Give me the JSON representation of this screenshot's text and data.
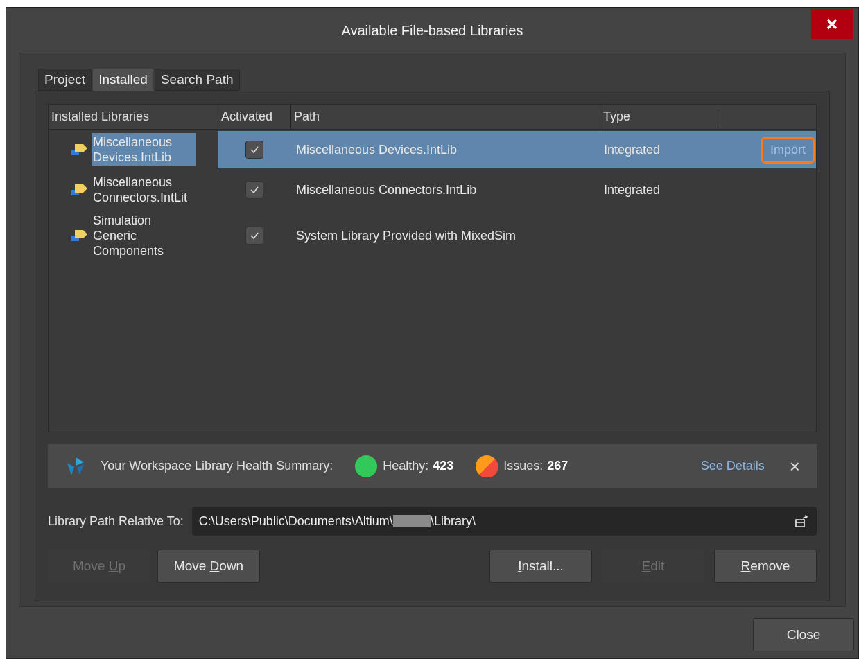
{
  "window": {
    "title": "Available File-based Libraries"
  },
  "tabs": [
    {
      "label": "Project",
      "selected": false
    },
    {
      "label": "Installed",
      "selected": true
    },
    {
      "label": "Search Path",
      "selected": false
    }
  ],
  "table": {
    "columns": [
      "Installed Libraries",
      "Activated",
      "Path",
      "Type"
    ],
    "rows": [
      {
        "name": "Miscellaneous Devices.IntLib",
        "activated": true,
        "path": "Miscellaneous Devices.IntLib",
        "type": "Integrated",
        "selected": true,
        "action": {
          "label": "Import",
          "highlighted": true
        }
      },
      {
        "name": "Miscellaneous Connectors.IntLit",
        "activated": true,
        "path": "Miscellaneous Connectors.IntLib",
        "type": "Integrated",
        "selected": false
      },
      {
        "name": "Simulation Generic Components",
        "activated": true,
        "path": "System Library Provided with MixedSim",
        "selected": false
      }
    ]
  },
  "health": {
    "label": "Your Workspace Library Health Summary:",
    "healthy_label": "Healthy:",
    "healthy_count": "423",
    "issues_label": "Issues:",
    "issues_count": "267",
    "link": "See Details",
    "close": "×"
  },
  "path_field": {
    "label": "Library Path Relative To:",
    "value_start": "C:\\Users\\Public\\Documents\\Altium\\",
    "redacted": true,
    "value_end": "\\Library\\"
  },
  "left_buttons": [
    {
      "before": "Move ",
      "key": "U",
      "after": "p",
      "disabled": true
    },
    {
      "before": "Move ",
      "key": "D",
      "after": "own",
      "disabled": false
    }
  ],
  "right_buttons": [
    {
      "key": "I",
      "after": "nstall...",
      "disabled": false
    },
    {
      "key": "E",
      "after": "dit",
      "disabled": true
    },
    {
      "key": "R",
      "after": "emove",
      "disabled": false
    }
  ],
  "close_button": {
    "key": "C",
    "after": "lose"
  }
}
